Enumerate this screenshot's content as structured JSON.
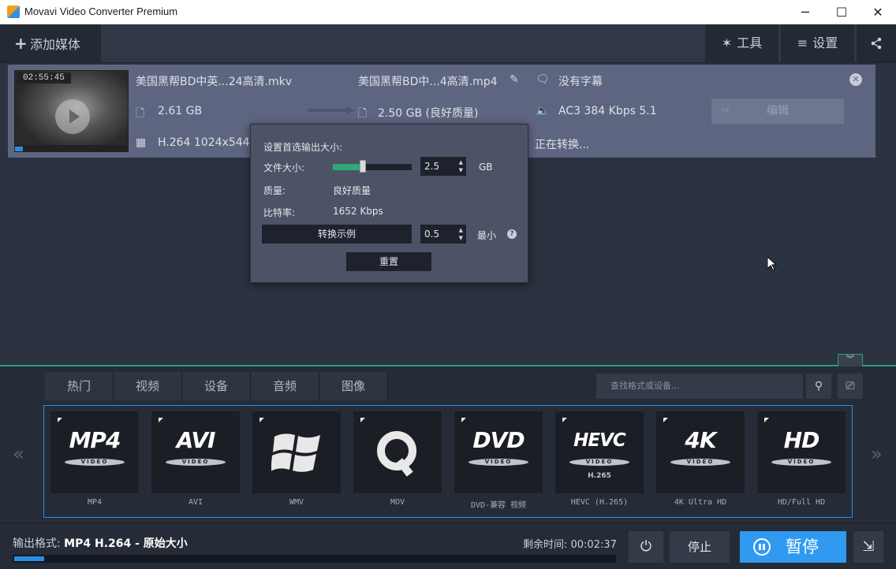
{
  "window": {
    "title": "Movavi Video Converter Premium",
    "minimize": "─",
    "maximize": "☐",
    "close": "✕"
  },
  "toolbar": {
    "add_media": "添加媒体",
    "tools": "工具",
    "settings": "设置",
    "tools_icon": "magic-wand-icon",
    "settings_icon": "menu-icon",
    "share_icon": "share-icon"
  },
  "file": {
    "duration": "02:55:45",
    "source_name": "美国黑帮BD中英...24高清.mkv",
    "source_size": "2.61 GB",
    "source_codec": "H.264 1024x544",
    "output_name": "美国黑帮BD中...4高清.mp4",
    "output_size": "2.50 GB (良好质量)",
    "subtitles": "没有字幕",
    "audio": "AC3 384 Kbps 5.1",
    "status": "正在转换...",
    "edit_label": "编辑",
    "thumb_progress": 0.07
  },
  "popup": {
    "heading": "设置首选输出大小:",
    "file_size_label": "文件大小:",
    "file_size_value": "2.5",
    "file_size_unit": "GB",
    "slider_level": 0.38,
    "quality_label": "质量:",
    "quality_value": "良好质量",
    "bitrate_label": "比特率:",
    "bitrate_value": "1652 Kbps",
    "sample_button": "转换示例",
    "sample_value": "0.5",
    "sample_unit": "最小",
    "help": "?",
    "reset_button": "重置"
  },
  "tabs": [
    "热门",
    "视频",
    "设备",
    "音频",
    "图像"
  ],
  "search": {
    "placeholder": "查找格式或设备..."
  },
  "formats": [
    {
      "big": "MP4",
      "disc": "VIDEO",
      "sub": "",
      "label": "MP4"
    },
    {
      "big": "AVI",
      "disc": "VIDEO",
      "sub": "",
      "label": "AVI"
    },
    {
      "big": "⊞",
      "disc": "",
      "sub": "",
      "label": "WMV"
    },
    {
      "big": "Q",
      "disc": "",
      "sub": "",
      "label": "MOV"
    },
    {
      "big": "DVD",
      "disc": "VIDEO",
      "sub": "",
      "label": "DVD-兼容 视频"
    },
    {
      "big": "HEVC",
      "disc": "VIDEO",
      "sub": "H.265",
      "label": "HEVC (H.265)"
    },
    {
      "big": "4K",
      "disc": "VIDEO",
      "sub": "",
      "label": "4K Ultra HD"
    },
    {
      "big": "HD",
      "disc": "VIDEO",
      "sub": "",
      "label": "HD/Full HD"
    }
  ],
  "nav": {
    "prev": "«",
    "next": "»"
  },
  "status": {
    "output_label": "输出格式: ",
    "output_value": "MP4 H.264 - 原始大小",
    "remaining": "剩余时间: 00:02:37",
    "progress": 0.05,
    "stop": "停止",
    "pause": "暂停"
  }
}
